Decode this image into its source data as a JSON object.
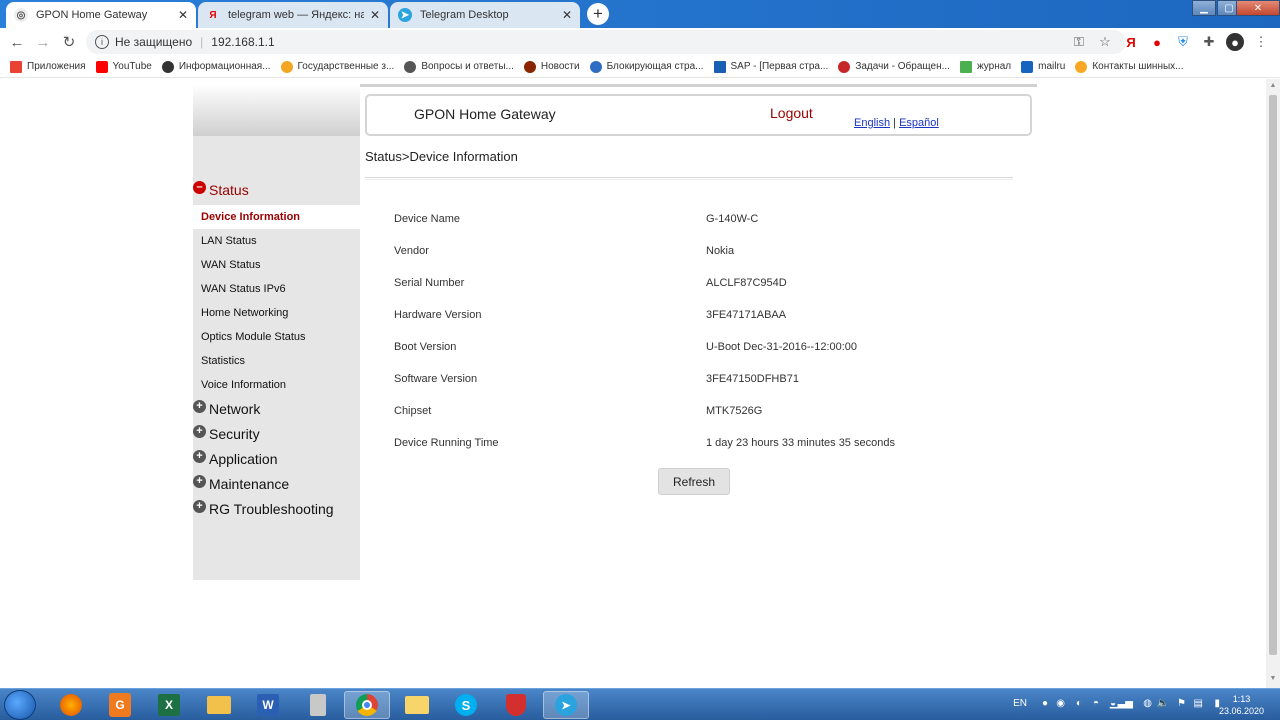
{
  "browser": {
    "tabs": [
      {
        "title": "GPON Home Gateway",
        "active": true
      },
      {
        "title": "telegram web — Яндекс: нашлось",
        "active": false
      },
      {
        "title": "Telegram Desktop",
        "active": false
      }
    ],
    "address": {
      "security_label": "Не защищено",
      "url": "192.168.1.1"
    },
    "bookmarks": [
      {
        "label": "Приложения",
        "color": "#e94235"
      },
      {
        "label": "YouTube",
        "color": "#ff0000"
      },
      {
        "label": "Информационная...",
        "color": "#333333"
      },
      {
        "label": "Государственные з...",
        "color": "#f4a623"
      },
      {
        "label": "Вопросы и ответы...",
        "color": "#555555"
      },
      {
        "label": "Новости",
        "color": "#8b2500"
      },
      {
        "label": "Блокирующая стра...",
        "color": "#2f6cc4"
      },
      {
        "label": "SAP - [Первая стра...",
        "color": "#1a5fb4"
      },
      {
        "label": "Задачи - Обращен...",
        "color": "#c62828"
      },
      {
        "label": "журнал",
        "color": "#4caf50"
      },
      {
        "label": "mailru",
        "color": "#1565c0"
      },
      {
        "label": "Контакты шинных...",
        "color": "#f9a825"
      }
    ]
  },
  "gateway": {
    "title": "GPON Home Gateway",
    "logout": "Logout",
    "lang_english": "English",
    "lang_sep": "|",
    "lang_spanish": "Español",
    "breadcrumb": "Status>Device Information"
  },
  "menu": {
    "groups": {
      "status": "Status",
      "network": "Network",
      "security": "Security",
      "application": "Application",
      "maintenance": "Maintenance",
      "rg": "RG Troubleshooting"
    },
    "status_items": [
      "Device Information",
      "LAN Status",
      "WAN Status",
      "WAN Status IPv6",
      "Home Networking",
      "Optics Module Status",
      "Statistics",
      "Voice Information"
    ]
  },
  "device_info": [
    {
      "label": "Device Name",
      "value": "G-140W-C"
    },
    {
      "label": "Vendor",
      "value": "Nokia"
    },
    {
      "label": "Serial Number",
      "value": "ALCLF87C954D"
    },
    {
      "label": "Hardware Version",
      "value": "3FE47171ABAA"
    },
    {
      "label": "Boot Version",
      "value": "U-Boot Dec-31-2016--12:00:00"
    },
    {
      "label": "Software Version",
      "value": "3FE47150DFHB71"
    },
    {
      "label": "Chipset",
      "value": "MTK7526G"
    },
    {
      "label": "Device Running Time",
      "value": "1 day 23 hours 33 minutes 35 seconds"
    }
  ],
  "refresh_label": "Refresh",
  "taskbar": {
    "lang": "EN",
    "time": "1:13",
    "date": "23.06.2020"
  }
}
